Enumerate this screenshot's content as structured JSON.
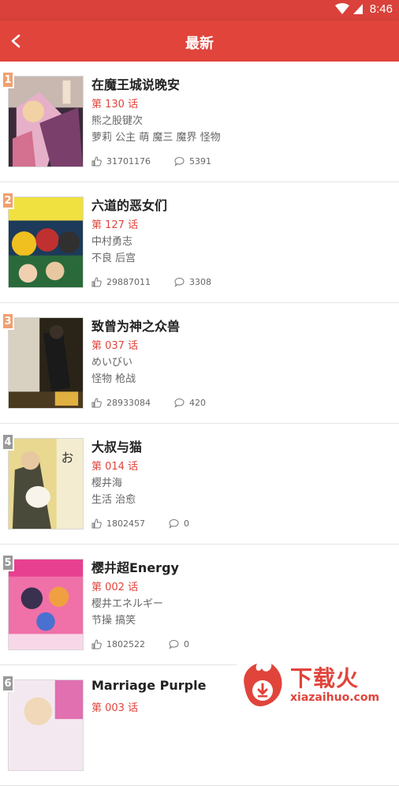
{
  "status": {
    "time": "8:46"
  },
  "appbar": {
    "title": "最新"
  },
  "items": [
    {
      "rank": "1",
      "rank_color": "#f0a070",
      "title": "在魔王城说晚安",
      "chapter": "第 130 话",
      "author": "熊之股键次",
      "tags": "萝莉 公主 萌 魔三 魔界 怪物",
      "likes": "31701176",
      "comments": "5391"
    },
    {
      "rank": "2",
      "rank_color": "#f0a070",
      "title": "六道的恶女们",
      "chapter": "第 127 话",
      "author": "中村勇志",
      "tags": "不良 后宫",
      "likes": "29887011",
      "comments": "3308"
    },
    {
      "rank": "3",
      "rank_color": "#f0a070",
      "title": "致曾为神之众兽",
      "chapter": "第 037 话",
      "author": "めいびい",
      "tags": "怪物 枪战",
      "likes": "28933084",
      "comments": "420"
    },
    {
      "rank": "4",
      "rank_color": "#999999",
      "title": "大叔与猫",
      "chapter": "第 014 话",
      "author": "樱井海",
      "tags": "生活 治愈",
      "likes": "1802457",
      "comments": "0"
    },
    {
      "rank": "5",
      "rank_color": "#999999",
      "title": "樱井超Energy",
      "chapter": "第 002 话",
      "author": "樱井エネルギー",
      "tags": "节操 搞笑",
      "likes": "1802522",
      "comments": "0"
    },
    {
      "rank": "6",
      "rank_color": "#999999",
      "title": "Marriage Purple",
      "chapter": "第 003 话",
      "author": "",
      "tags": "",
      "likes": "",
      "comments": ""
    }
  ],
  "watermark": {
    "brand_cn": "下载火",
    "brand_url": "xiazaihuo.com"
  },
  "colors": {
    "accent": "#e0443b",
    "status_bar": "#d9413a"
  },
  "icons": {
    "back": "chevron-left-icon",
    "likes": "thumbs-up-icon",
    "comments": "comment-bubble-icon",
    "wifi": "wifi-icon"
  }
}
